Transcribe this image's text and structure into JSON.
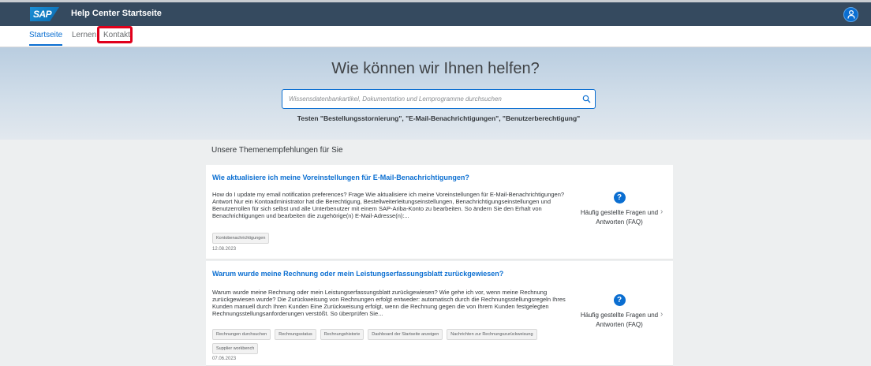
{
  "shell": {
    "logo_text": "SAP",
    "title": "Help Center Startseite",
    "accent": "#0a6ed1"
  },
  "tabs": [
    {
      "label": "Startseite",
      "active": true
    },
    {
      "label": "Lernen",
      "active": false
    },
    {
      "label": "Kontakt",
      "active": false,
      "highlighted": true
    }
  ],
  "hero": {
    "title": "Wie können wir Ihnen helfen?",
    "search_placeholder": "Wissensdatenbankartikel, Dokumentation und Lernprogramme durchsuchen",
    "try_text": "Testen  \"Bestellungsstornierung\", \"E-Mail-Benachrichtigungen\", \"Benutzerberechtigung\""
  },
  "recommendations": {
    "section_title": "Unsere Themenempfehlungen für Sie",
    "cards": [
      {
        "title": "Wie aktualisiere ich meine Voreinstellungen für E-Mail-Benachrichtigungen?",
        "body": "How do I update my email notification preferences? Frage Wie aktualisiere ich meine Voreinstellungen für E-Mail-Benachrichtigungen? Antwort Nur ein Kontoadministrator hat die Berechtigung, Bestellweiterleitungseinstellungen, Benachrichtigungseinstellungen und Benutzerrollen für sich selbst und alle Unterbenutzer mit einem SAP-Ariba-Konto zu bearbeiten. So ändern Sie den Erhalt von Benachrichtigungen und bearbeiten die zugehörige(n) E-Mail-Adresse(n):...",
        "tags": [
          "Kontobenachrichtigungen"
        ],
        "date": "12.08.2023",
        "type_icon": "question-icon",
        "type_label": "Häufig gestellte Fragen und Antworten (FAQ)"
      },
      {
        "title": "Warum wurde meine Rechnung oder mein Leistungserfassungsblatt zurückgewiesen?",
        "body": "Warum wurde meine Rechnung oder mein Leistungserfassungsblatt zurückgewiesen? Wie gehe ich vor, wenn meine Rechnung zurückgewiesen wurde? Die Zurückweisung von Rechnungen erfolgt entweder: automatisch durch die Rechnungsstellungsregeln Ihres Kunden manuell durch Ihren Kunden Eine Zurückweisung erfolgt, wenn die Rechnung gegen die von Ihrem Kunden festgelegten Rechnungsstellungsanforderungen verstößt. So überprüfen Sie...",
        "tags": [
          "Rechnungen durchsuchen",
          "Rechnungsstatus",
          "Rechnungshistorie",
          "Dashboard der Startseite anzeigen",
          "Nachrichten zur Rechnungszurückweisung",
          "Supplier workbench"
        ],
        "date": "07.06.2023",
        "type_icon": "question-icon",
        "type_label": "Häufig gestellte Fragen und Antworten (FAQ)"
      }
    ]
  }
}
